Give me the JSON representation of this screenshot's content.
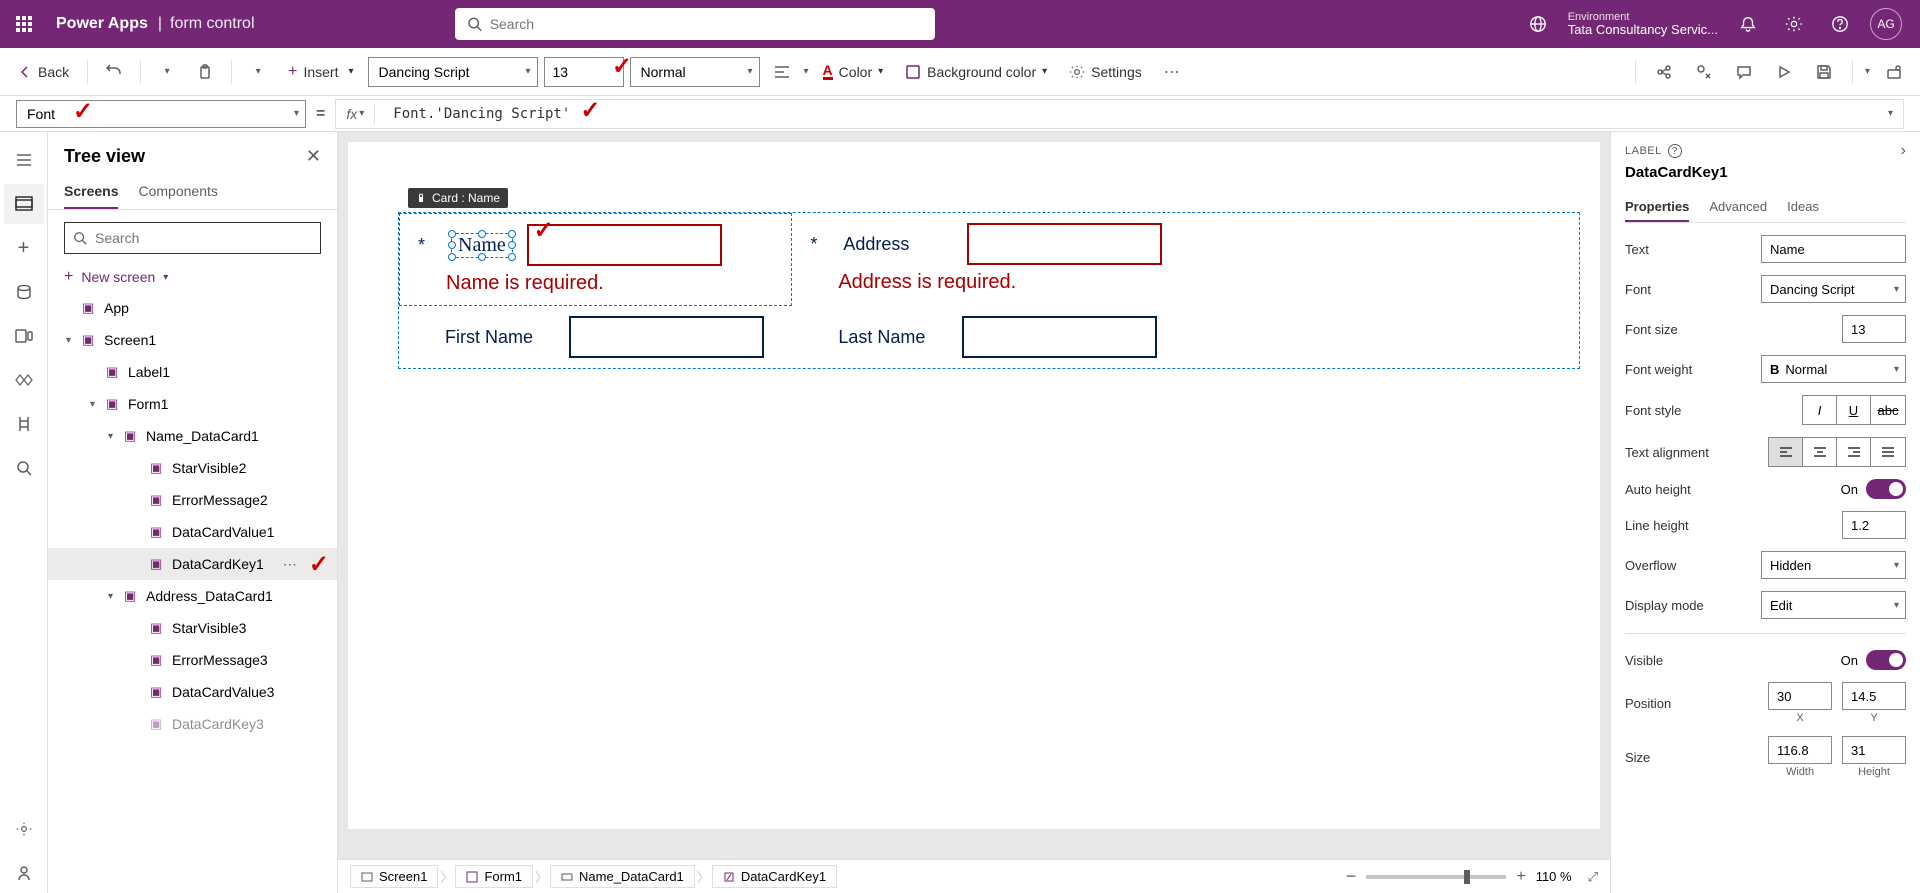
{
  "header": {
    "app": "Power Apps",
    "sep": "|",
    "sub": "form control",
    "search_placeholder": "Search",
    "env_label": "Environment",
    "env_value": "Tata Consultancy Servic...",
    "avatar": "AG"
  },
  "cmdbar": {
    "back": "Back",
    "insert": "Insert",
    "font": "Dancing Script",
    "size": "13",
    "weight": "Normal",
    "color": "Color",
    "bgcolor": "Background color",
    "settings": "Settings"
  },
  "formula": {
    "prop": "Font",
    "eq": "=",
    "fx": "fx",
    "expr": "Font.'Dancing Script'"
  },
  "tree": {
    "title": "Tree view",
    "tab_screens": "Screens",
    "tab_components": "Components",
    "search_placeholder": "Search",
    "new_screen": "New screen",
    "items": [
      {
        "label": "App",
        "indent": 18
      },
      {
        "label": "Screen1",
        "indent": 18,
        "chev": true
      },
      {
        "label": "Label1",
        "indent": 42
      },
      {
        "label": "Form1",
        "indent": 42,
        "chev": true
      },
      {
        "label": "Name_DataCard1",
        "indent": 60,
        "chev": true
      },
      {
        "label": "StarVisible2",
        "indent": 86
      },
      {
        "label": "ErrorMessage2",
        "indent": 86
      },
      {
        "label": "DataCardValue1",
        "indent": 86
      },
      {
        "label": "DataCardKey1",
        "indent": 86,
        "sel": true,
        "more": true
      },
      {
        "label": "Address_DataCard1",
        "indent": 60,
        "chev": true
      },
      {
        "label": "StarVisible3",
        "indent": 86
      },
      {
        "label": "ErrorMessage3",
        "indent": 86
      },
      {
        "label": "DataCardValue3",
        "indent": 86
      },
      {
        "label": "DataCardKey3",
        "indent": 86,
        "fade": true
      }
    ]
  },
  "canvas": {
    "card_tag": "Card : Name",
    "name_lbl": "Name",
    "name_err": "Name is required.",
    "addr_lbl": "Address",
    "addr_err": "Address is required.",
    "fn_lbl": "First Name",
    "ln_lbl": "Last Name"
  },
  "crumbs": {
    "c1": "Screen1",
    "c2": "Form1",
    "c3": "Name_DataCard1",
    "c4": "DataCardKey1",
    "zoom": "110 %",
    "minus": "−",
    "plus": "+"
  },
  "props": {
    "type": "LABEL",
    "name": "DataCardKey1",
    "tab_props": "Properties",
    "tab_adv": "Advanced",
    "tab_ideas": "Ideas",
    "lbl_text": "Text",
    "val_text": "Name",
    "lbl_font": "Font",
    "val_font": "Dancing Script",
    "lbl_size": "Font size",
    "val_size": "13",
    "lbl_weight": "Font weight",
    "val_weight": "Normal",
    "lbl_style": "Font style",
    "lbl_align": "Text alignment",
    "lbl_autoh": "Auto height",
    "on": "On",
    "lbl_lh": "Line height",
    "val_lh": "1.2",
    "lbl_overflow": "Overflow",
    "val_overflow": "Hidden",
    "lbl_dmode": "Display mode",
    "val_dmode": "Edit",
    "lbl_visible": "Visible",
    "lbl_pos": "Position",
    "val_x": "30",
    "val_y": "14.5",
    "sub_x": "X",
    "sub_y": "Y",
    "lbl_size2": "Size",
    "val_w": "116.8",
    "val_h": "31",
    "sub_w": "Width",
    "sub_h": "Height"
  }
}
